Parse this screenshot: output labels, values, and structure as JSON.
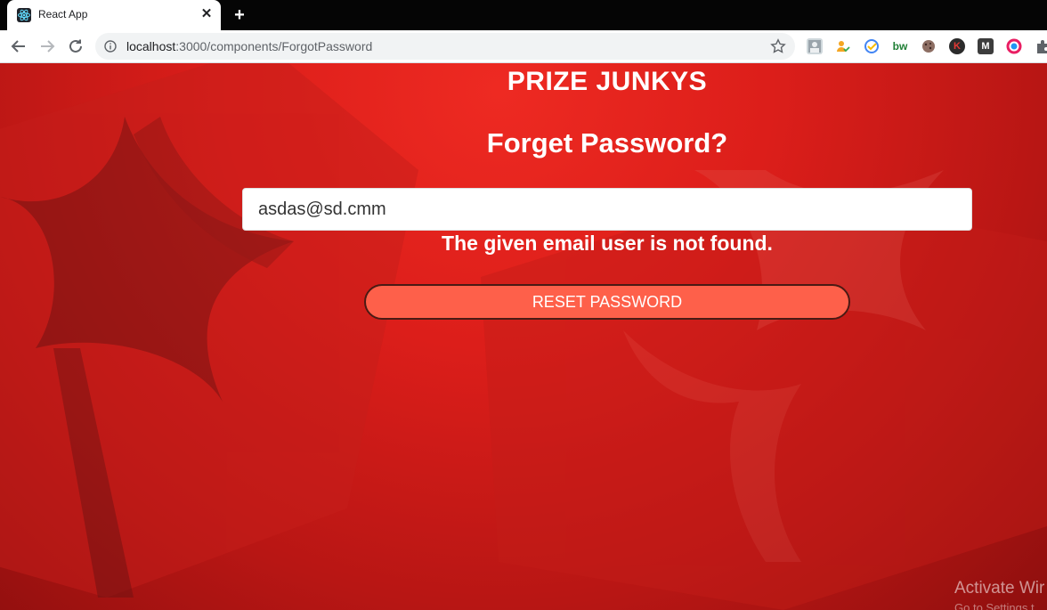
{
  "browser": {
    "tab": {
      "title": "React App",
      "close_glyph": "✕",
      "favicon": "react-logo-icon"
    },
    "new_tab_glyph": "+",
    "address_bar": {
      "host": "localhost",
      "path": ":3000/components/ForgotPassword"
    },
    "extensions": [
      "profile-icon",
      "person-check-icon",
      "google-keep-icon",
      "bw-icon",
      "cookie-icon",
      "k-icon",
      "m-icon",
      "color-circle-icon",
      "puzzle-icon"
    ],
    "ext_labels": {
      "bw": "bw",
      "k": "K",
      "m": "M"
    }
  },
  "page": {
    "brand": "PRIZE JUNKYS",
    "heading": "Forget Password?",
    "email_value": "asdas@sd.cmm",
    "error_message": "The given email user is not found.",
    "reset_button_label": "RESET PASSWORD",
    "watermark_title": "Activate Wir",
    "watermark_sub": "Go to Settings t"
  },
  "colors": {
    "background": "#dc1e1a",
    "button": "#fe604a",
    "text": "#ffffff"
  }
}
